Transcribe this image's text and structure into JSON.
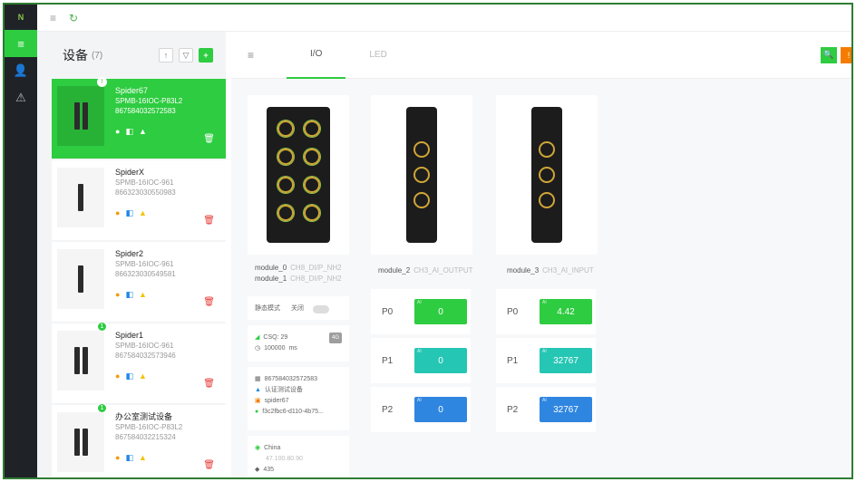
{
  "rail": {
    "logo": "N",
    "items": [
      "≡",
      "👤",
      "⚠"
    ]
  },
  "topbar": {
    "menu_icon": "≡",
    "refresh_icon": "↻"
  },
  "devices": {
    "title": "设备",
    "count": "(7)",
    "btn_a": "↑",
    "btn_b": "▽",
    "btn_add": "+",
    "list": [
      {
        "name": "Spider67",
        "model": "SPMB-16IOC-P83L2",
        "serial": "867584032572583",
        "badge": "!"
      },
      {
        "name": "SpiderX",
        "model": "SPMB-16IOC-961",
        "serial": "866323030550983",
        "badge": ""
      },
      {
        "name": "Spider2",
        "model": "SPMB-16IOC-961",
        "serial": "866323030549581",
        "badge": ""
      },
      {
        "name": "Spider1",
        "model": "SPMB-16IOC-961",
        "serial": "867584032573946",
        "badge": "1"
      },
      {
        "name": "办公室测试设备",
        "model": "SPMB-16IOC-P83L2",
        "serial": "867584032215324",
        "badge": "1"
      }
    ]
  },
  "main": {
    "menu_icon": "≡",
    "tabs": [
      "I/O",
      "LED"
    ],
    "tool_a": "🔍",
    "tool_b": "!"
  },
  "modules": {
    "m0_label": "module_0",
    "m0_sub": "CH8_DI/P_NH2",
    "m1_label": "module_1",
    "m1_sub": "CH8_DI/P_NH2",
    "m2_label": "module_2",
    "m2_sub": "CH3_AI_OUTPUT",
    "m3_label": "module_3",
    "m3_sub": "CH3_AI_INPUT"
  },
  "io": {
    "left": [
      {
        "label": "P0",
        "value": "0",
        "color": "#2ecc40"
      },
      {
        "label": "P1",
        "value": "0",
        "color": "#26c6b4"
      },
      {
        "label": "P2",
        "value": "0",
        "color": "#2f86e0"
      }
    ],
    "right": [
      {
        "label": "P0",
        "value": "4.42",
        "color": "#2ecc40"
      },
      {
        "label": "P1",
        "value": "32767",
        "color": "#26c6b4"
      },
      {
        "label": "P2",
        "value": "32767",
        "color": "#2f86e0"
      }
    ]
  },
  "info": {
    "mode_label": "静态模式",
    "mode_value": "关闭",
    "csq": "CSQ: 29",
    "csq_tag": "4G",
    "rate": "100000",
    "rate_unit": "ms",
    "imei": "867584032572583",
    "group": "认证测试设备",
    "name": "spider67",
    "id": "f3c2fbc6-d110-4b75...",
    "location": "China",
    "location_sub": "47.100.80.90",
    "number": "435"
  }
}
